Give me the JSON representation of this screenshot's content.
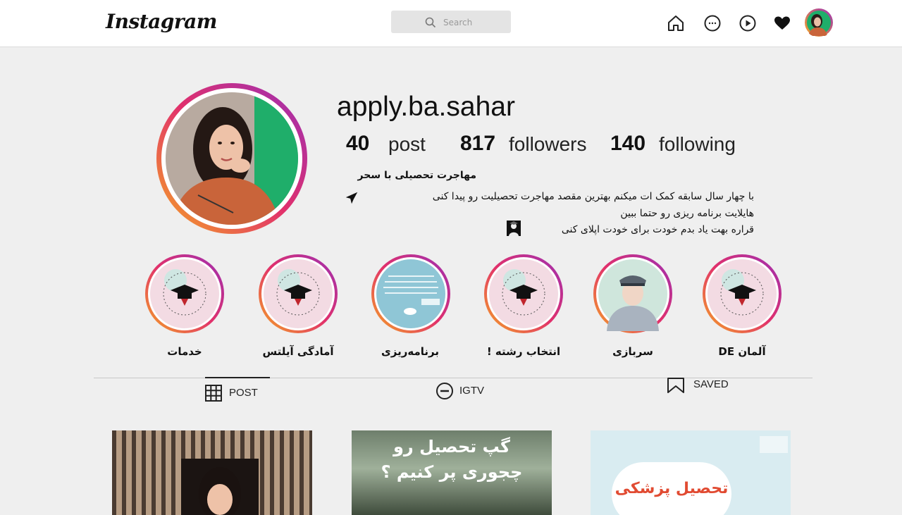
{
  "header": {
    "logo": "Instagram",
    "search_placeholder": "Search",
    "icons": [
      "home-icon",
      "messenger-icon",
      "explore-icon",
      "heart-icon",
      "profile-avatar"
    ]
  },
  "profile": {
    "username": "apply.ba.sahar",
    "stats": [
      {
        "value": "40",
        "label": "post"
      },
      {
        "value": "817",
        "label": "followers"
      },
      {
        "value": "140",
        "label": "following"
      }
    ],
    "bio_title": "مهاجرت تحصیلی با سحر",
    "bio_lines": [
      "با چهار سال سابقه کمک ات میکنم بهترین مقصد مهاجرت تحصیلیت رو پیدا کنی",
      "هایلایت برنامه ریزی رو حتما ببین",
      "قراره بهت یاد بدم خودت برای خودت اپلای کنی"
    ]
  },
  "highlights": [
    {
      "label": "خدمات"
    },
    {
      "label": "آمادگی آیلتس"
    },
    {
      "label": "برنامه‌ریزی"
    },
    {
      "label": "انتخاب رشته !"
    },
    {
      "label": "سربازی"
    },
    {
      "label": "آلمان DE"
    }
  ],
  "tabs": [
    {
      "label": "POST",
      "active": true
    },
    {
      "label": "IGTV",
      "active": false
    },
    {
      "label": "SAVED",
      "active": false
    }
  ],
  "posts": [
    {
      "caption": ""
    },
    {
      "caption_line1": "گپ تحصیل رو",
      "caption_line2": "چجوری پر کنیم ؟"
    },
    {
      "caption": "تحصیل پزشکی"
    }
  ],
  "colors": {
    "ring_gradient": [
      "#f5a623",
      "#e1306c",
      "#9b2fb5"
    ],
    "accent_green": "#1fae6a"
  }
}
